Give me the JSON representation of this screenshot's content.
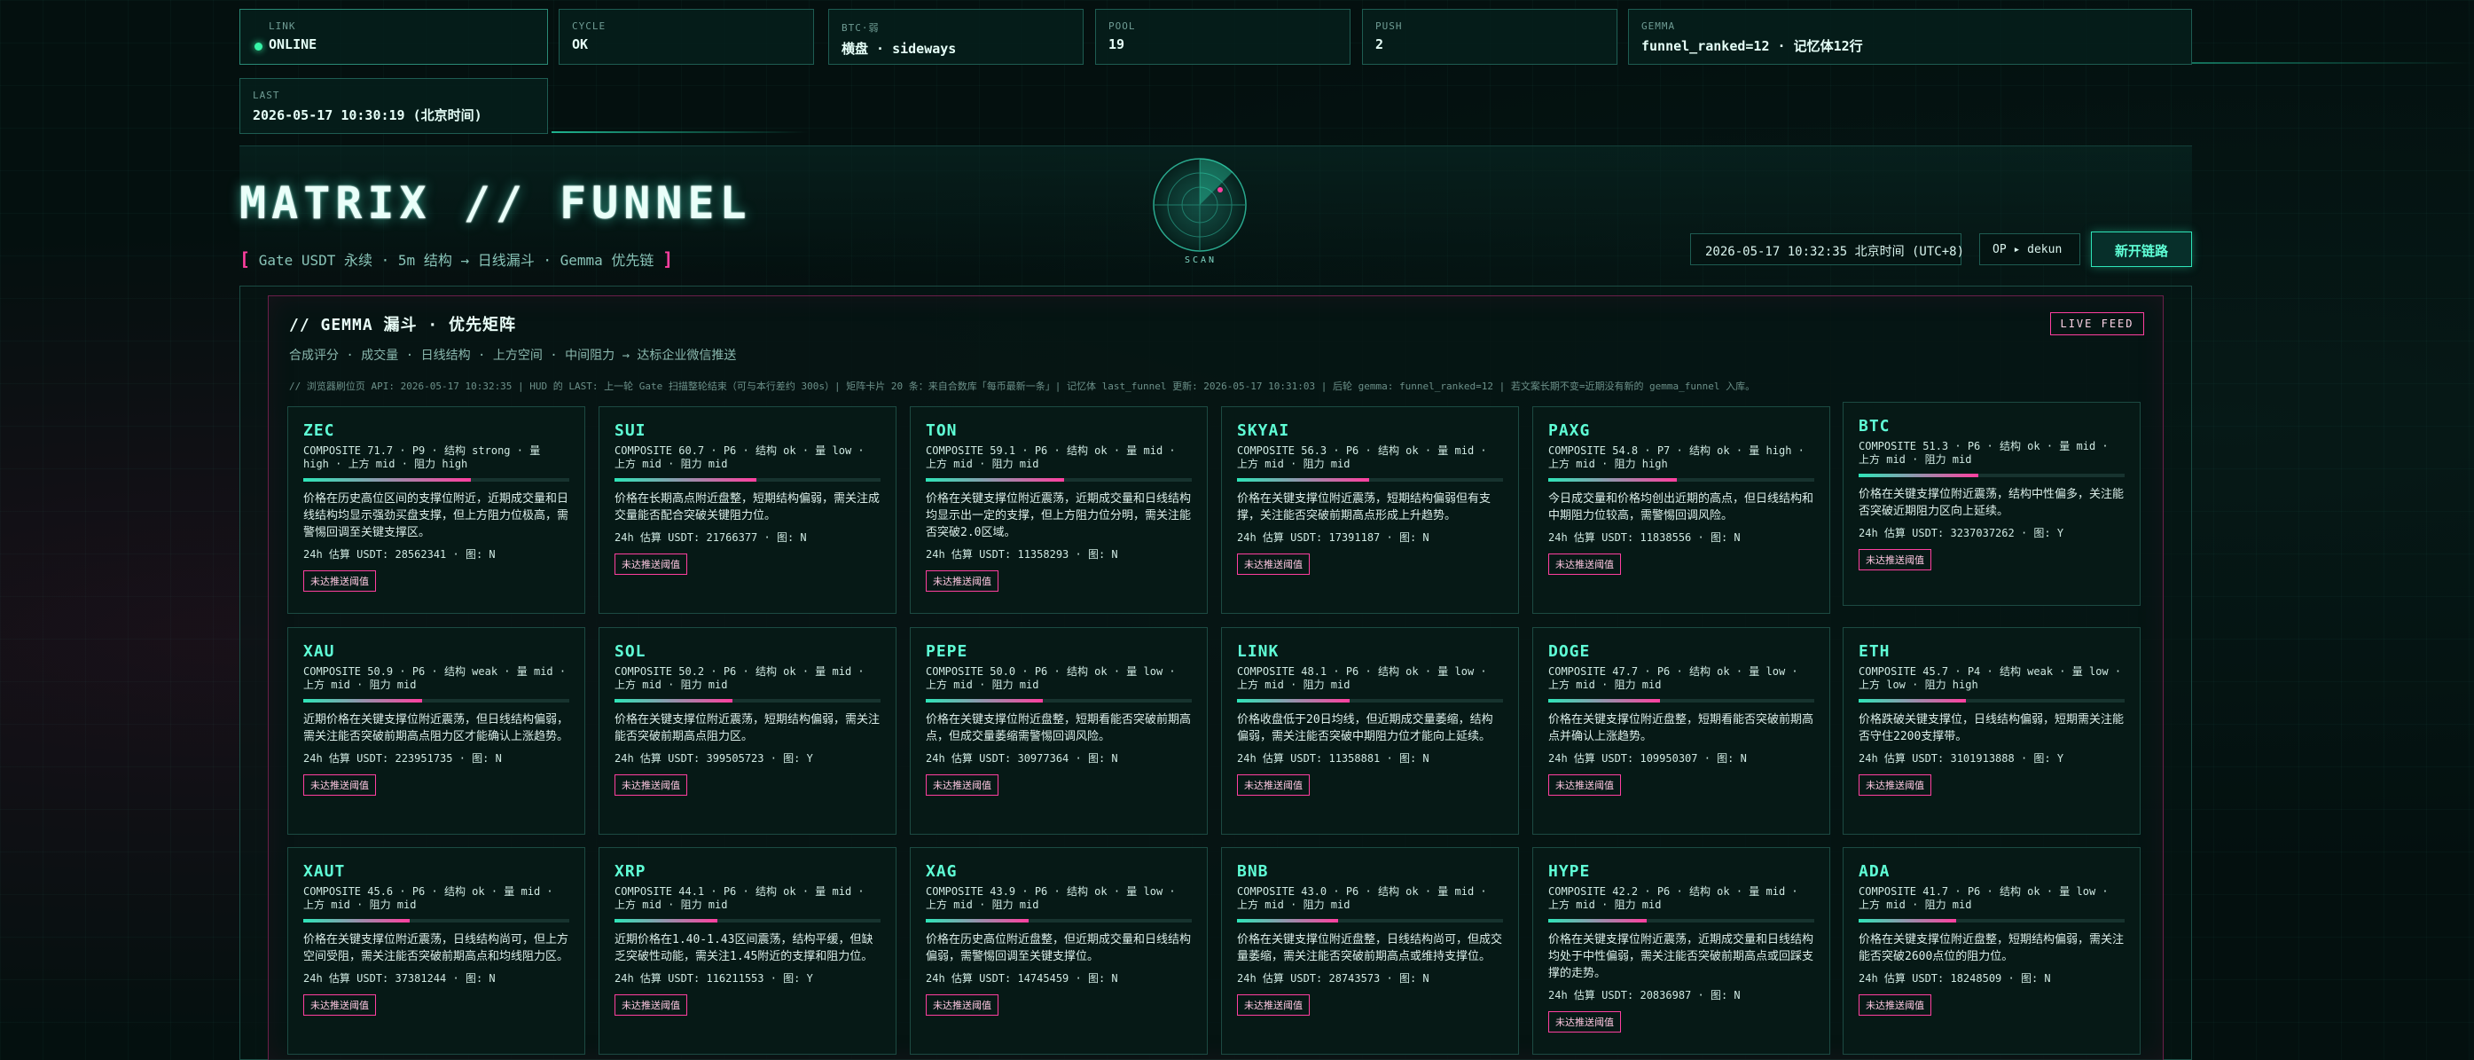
{
  "status": {
    "link": {
      "label": "LINK",
      "value": "ONLINE"
    },
    "cycle": {
      "label": "CYCLE",
      "value": "OK"
    },
    "btc": {
      "label": "BTC·弱",
      "value": "横盘 · sideways"
    },
    "pool": {
      "label": "POOL",
      "value": "19"
    },
    "push": {
      "label": "PUSH",
      "value": "2"
    },
    "gemma": {
      "label": "GEMMA",
      "value": "funnel_ranked=12 · 记忆体12行"
    },
    "last": {
      "label": "LAST",
      "value": "2026-05-17 10:30:19 (北京时间)"
    }
  },
  "header": {
    "title": "MATRIX // FUNNEL",
    "subtitle_open": "[",
    "subtitle": "Gate USDT 永续 · 5m 结构 → 日线漏斗 · Gemma 优先链",
    "subtitle_close": "]",
    "radar_label": "SCAN",
    "clock": "2026-05-17 10:32:35 北京时间 (UTC+8)",
    "operator": "OP ▸ dekun",
    "new_link": "新开链路"
  },
  "panel": {
    "title": "// GEMMA 漏斗 · 优先矩阵",
    "live": "LIVE FEED",
    "subtitle": "合成评分 · 成交量 · 日线结构 · 上方空间 · 中间阻力 → 达标企业微信推送",
    "note": "// 浏览器刷位页 API: 2026-05-17 10:32:35 | HUD 的 LAST: 上一轮 Gate 扫描整轮结束（可与本行差约 300s）| 矩阵卡片 20 条：来自合数库「每币最新一条」| 记忆体 last_funnel 更新: 2026-05-17 10:31:03 | 后轮 gemma: funnel_ranked=12 | 若文案长期不变=近期没有新的 gemma_funnel 入库。"
  },
  "cards": [
    {
      "sym": "ZEC",
      "meta": "COMPOSITE 71.7 · P9 · 结构 strong · 量 high · 上方 mid · 阻力 high",
      "score": 71.7,
      "desc": "价格在历史高位区间的支撑位附近，近期成交量和日线结构均显示强劲买盘支撑，但上方阻力位极高，需警惕回调至关键支撑区。",
      "usdt": "24h 估算 USDT: 28562341 · 图: N",
      "tag": "未达推送阈值"
    },
    {
      "sym": "SUI",
      "meta": "COMPOSITE 60.7 · P6 · 结构 ok · 量 low · 上方 mid · 阻力 mid",
      "score": 60.7,
      "desc": "价格在长期高点附近盘整，短期结构偏弱，需关注成交量能否配合突破关键阻力位。",
      "usdt": "24h 估算 USDT: 21766377 · 图: N",
      "tag": "未达推送阈值"
    },
    {
      "sym": "TON",
      "meta": "COMPOSITE 59.1 · P6 · 结构 ok · 量 mid · 上方 mid · 阻力 mid",
      "score": 59.1,
      "desc": "价格在关键支撑位附近震荡，近期成交量和日线结构均显示出一定的支撑，但上方阻力位分明，需关注能否突破2.0区域。",
      "usdt": "24h 估算 USDT: 11358293 · 图: N",
      "tag": "未达推送阈值"
    },
    {
      "sym": "SKYAI",
      "meta": "COMPOSITE 56.3 · P6 · 结构 ok · 量 mid · 上方 mid · 阻力 mid",
      "score": 56.3,
      "desc": "价格在关键支撑位附近震荡，短期结构偏弱但有支撑，关注能否突破前期高点形成上升趋势。",
      "usdt": "24h 估算 USDT: 17391187 · 图: N",
      "tag": "未达推送阈值"
    },
    {
      "sym": "PAXG",
      "meta": "COMPOSITE 54.8 · P7 · 结构 ok · 量 high · 上方 mid · 阻力 high",
      "score": 54.8,
      "desc": "今日成交量和价格均创出近期的高点，但日线结构和中期阻力位较高，需警惕回调风险。",
      "usdt": "24h 估算 USDT: 11838556 · 图: N",
      "tag": "未达推送阈值"
    },
    {
      "sym": "BTC",
      "meta": "COMPOSITE 51.3 · P6 · 结构 ok · 量 mid · 上方 mid · 阻力 mid",
      "score": 51.3,
      "desc": "价格在关键支撑位附近震荡，结构中性偏多，关注能否突破近期阻力区向上延续。",
      "usdt": "24h 估算 USDT: 3237037262 · 图: Y",
      "tag": "未达推送阈值"
    },
    {
      "sym": "XAU",
      "meta": "COMPOSITE 50.9 · P6 · 结构 weak · 量 mid · 上方 mid · 阻力 mid",
      "score": 50.9,
      "desc": "近期价格在关键支撑位附近震荡，但日线结构偏弱，需关注能否突破前期高点阻力区才能确认上涨趋势。",
      "usdt": "24h 估算 USDT: 223951735 · 图: N",
      "tag": "未达推送阈值"
    },
    {
      "sym": "SOL",
      "meta": "COMPOSITE 50.2 · P6 · 结构 ok · 量 mid · 上方 mid · 阻力 mid",
      "score": 50.2,
      "desc": "价格在关键支撑位附近震荡，短期结构偏弱，需关注能否突破前期高点阻力区。",
      "usdt": "24h 估算 USDT: 399505723 · 图: Y",
      "tag": "未达推送阈值"
    },
    {
      "sym": "PEPE",
      "meta": "COMPOSITE 50.0 · P6 · 结构 ok · 量 low · 上方 mid · 阻力 mid",
      "score": 50.0,
      "desc": "价格在关键支撑位附近盘整，短期看能否突破前期高点，但成交量萎缩需警惕回调风险。",
      "usdt": "24h 估算 USDT: 30977364 · 图: N",
      "tag": "未达推送阈值"
    },
    {
      "sym": "LINK",
      "meta": "COMPOSITE 48.1 · P6 · 结构 ok · 量 low · 上方 mid · 阻力 mid",
      "score": 48.1,
      "desc": "价格收盘低于20日均线，但近期成交量萎缩，结构偏弱，需关注能否突破中期阻力位才能向上延续。",
      "usdt": "24h 估算 USDT: 11358881 · 图: N",
      "tag": "未达推送阈值"
    },
    {
      "sym": "DOGE",
      "meta": "COMPOSITE 47.7 · P6 · 结构 ok · 量 low · 上方 mid · 阻力 mid",
      "score": 47.7,
      "desc": "价格在关键支撑位附近盘整，短期看能否突破前期高点并确认上涨趋势。",
      "usdt": "24h 估算 USDT: 109950307 · 图: N",
      "tag": "未达推送阈值"
    },
    {
      "sym": "ETH",
      "meta": "COMPOSITE 45.7 · P4 · 结构 weak · 量 low · 上方 low · 阻力 high",
      "score": 45.7,
      "desc": "价格跌破关键支撑位，日线结构偏弱，短期需关注能否守住2200支撑带。",
      "usdt": "24h 估算 USDT: 3101913888 · 图: Y",
      "tag": "未达推送阈值"
    },
    {
      "sym": "XAUT",
      "meta": "COMPOSITE 45.6 · P6 · 结构 ok · 量 mid · 上方 mid · 阻力 mid",
      "score": 45.6,
      "desc": "价格在关键支撑位附近震荡，日线结构尚可，但上方空间受阻，需关注能否突破前期高点和均线阻力区。",
      "usdt": "24h 估算 USDT: 37381244 · 图: N",
      "tag": "未达推送阈值"
    },
    {
      "sym": "XRP",
      "meta": "COMPOSITE 44.1 · P6 · 结构 ok · 量 mid · 上方 mid · 阻力 mid",
      "score": 44.1,
      "desc": "近期价格在1.40-1.43区间震荡，结构平缓，但缺乏突破性动能，需关注1.45附近的支撑和阻力位。",
      "usdt": "24h 估算 USDT: 116211553 · 图: Y",
      "tag": "未达推送阈值"
    },
    {
      "sym": "XAG",
      "meta": "COMPOSITE 43.9 · P6 · 结构 ok · 量 low · 上方 mid · 阻力 mid",
      "score": 43.9,
      "desc": "价格在历史高位附近盘整，但近期成交量和日线结构偏弱，需警惕回调至关键支撑位。",
      "usdt": "24h 估算 USDT: 14745459 · 图: N",
      "tag": "未达推送阈值"
    },
    {
      "sym": "BNB",
      "meta": "COMPOSITE 43.0 · P6 · 结构 ok · 量 mid · 上方 mid · 阻力 mid",
      "score": 43.0,
      "desc": "价格在关键支撑位附近盘整，日线结构尚可，但成交量萎缩，需关注能否突破前期高点或维持支撑位。",
      "usdt": "24h 估算 USDT: 28743573 · 图: N",
      "tag": "未达推送阈值"
    },
    {
      "sym": "HYPE",
      "meta": "COMPOSITE 42.2 · P6 · 结构 ok · 量 mid · 上方 mid · 阻力 mid",
      "score": 42.2,
      "desc": "价格在关键支撑位附近震荡，近期成交量和日线结构均处于中性偏弱，需关注能否突破前期高点或回踩支撑的走势。",
      "usdt": "24h 估算 USDT: 20836987 · 图: N",
      "tag": "未达推送阈值"
    },
    {
      "sym": "ADA",
      "meta": "COMPOSITE 41.7 · P6 · 结构 ok · 量 low · 上方 mid · 阻力 mid",
      "score": 41.7,
      "desc": "价格在关键支撑位附近盘整，短期结构偏弱，需关注能否突破2600点位的阻力位。",
      "usdt": "24h 估算 USDT: 18248509 · 图: N",
      "tag": "未达推送阈值"
    }
  ],
  "colors": {
    "accent": "#5fffd6",
    "pink": "#ff3fa0",
    "bg": "#04100f"
  }
}
